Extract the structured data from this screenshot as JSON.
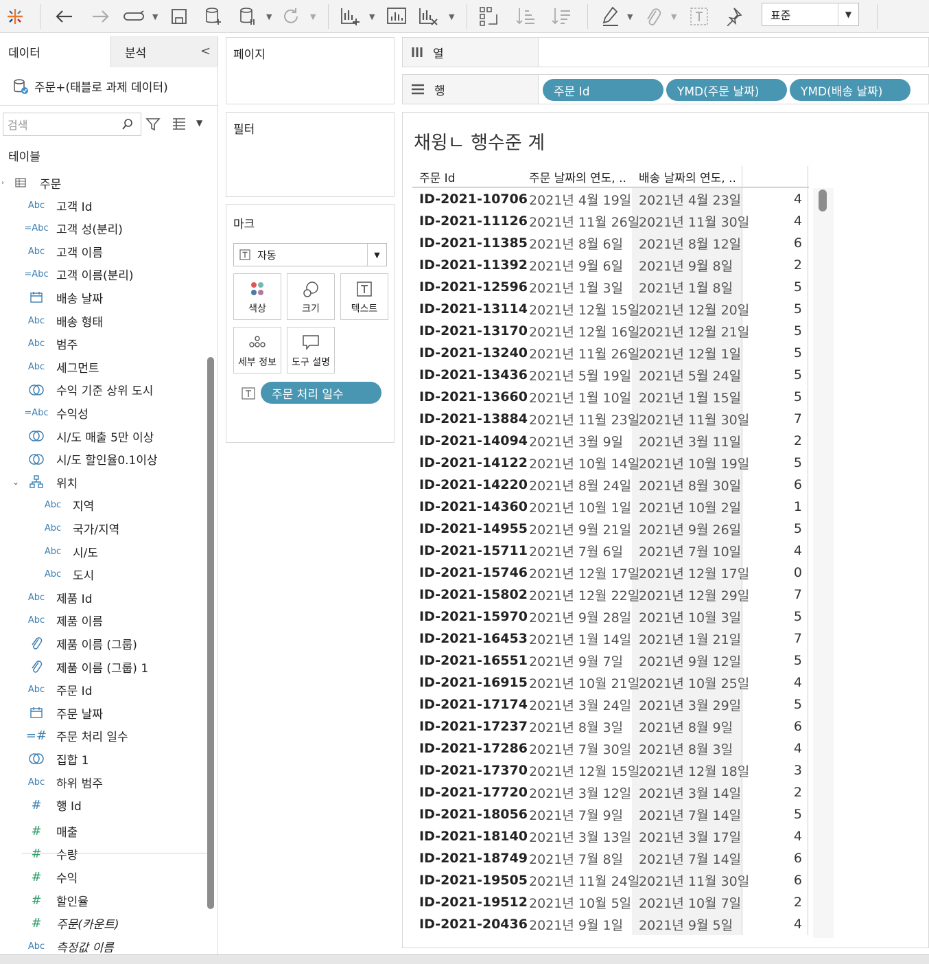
{
  "toolbar": {
    "icons": [
      "tableau-logo-icon",
      "undo-icon",
      "redo-icon",
      "replay-icon",
      "save-icon",
      "new-datasource-icon",
      "pause-update-icon",
      "refresh-icon",
      "new-worksheet-icon",
      "new-dashboard-icon",
      "clear-sheet-icon",
      "swap-icon",
      "sort-asc-icon",
      "sort-desc-icon",
      "highlight-icon",
      "group-icon",
      "show-labels-icon",
      "pin-icon"
    ],
    "fit_value": "표준"
  },
  "left_panel": {
    "tab_data": "데이터",
    "tab_analysis": "분석",
    "datasource": "주문+(태블로 과제 데이터)",
    "search_placeholder": "검색",
    "tables_header": "테이블",
    "table_name": "주문",
    "fields": [
      {
        "type": "Abc",
        "label": "고객 Id",
        "indent": 0
      },
      {
        "type": "=Abc",
        "label": "고객 성(분리)",
        "indent": 0
      },
      {
        "type": "Abc",
        "label": "고객 이름",
        "indent": 0
      },
      {
        "type": "=Abc",
        "label": "고객 이름(분리)",
        "indent": 0
      },
      {
        "type": "date",
        "label": "배송 날짜",
        "indent": 0
      },
      {
        "type": "Abc",
        "label": "배송 형태",
        "indent": 0
      },
      {
        "type": "Abc",
        "label": "범주",
        "indent": 0
      },
      {
        "type": "Abc",
        "label": "세그먼트",
        "indent": 0
      },
      {
        "type": "set",
        "label": "수익 기준 상위 도시",
        "indent": 0
      },
      {
        "type": "=Abc",
        "label": "수익성",
        "indent": 0
      },
      {
        "type": "set",
        "label": "시/도 매출 5만 이상",
        "indent": 0
      },
      {
        "type": "set",
        "label": "시/도 할인율0.1이상",
        "indent": 0
      },
      {
        "type": "hier",
        "label": "위치",
        "indent": 0
      },
      {
        "type": "Abc",
        "label": "지역",
        "indent": 1
      },
      {
        "type": "Abc",
        "label": "국가/지역",
        "indent": 1
      },
      {
        "type": "Abc",
        "label": "시/도",
        "indent": 1
      },
      {
        "type": "Abc",
        "label": "도시",
        "indent": 1
      },
      {
        "type": "Abc",
        "label": "제품 Id",
        "indent": 0
      },
      {
        "type": "Abc",
        "label": "제품 이름",
        "indent": 0
      },
      {
        "type": "clip",
        "label": "제품 이름 (그룹)",
        "indent": 0
      },
      {
        "type": "clip",
        "label": "제품 이름 (그룹) 1",
        "indent": 0
      },
      {
        "type": "Abc",
        "label": "주문 Id",
        "indent": 0
      },
      {
        "type": "date",
        "label": "주문 날짜",
        "indent": 0
      },
      {
        "type": "=#",
        "label": "주문 처리 일수",
        "indent": 0
      },
      {
        "type": "set",
        "label": "집합 1",
        "indent": 0
      },
      {
        "type": "Abc",
        "label": "하위 범주",
        "indent": 0
      },
      {
        "type": "#",
        "label": "행 Id",
        "indent": 0
      },
      {
        "type": "#g",
        "label": "매출",
        "indent": 0
      },
      {
        "type": "#g",
        "label": "수량",
        "indent": 0
      },
      {
        "type": "#g",
        "label": "수익",
        "indent": 0
      },
      {
        "type": "#g",
        "label": "할인율",
        "indent": 0
      },
      {
        "type": "#g",
        "label": "주문(카운트)",
        "indent": 0,
        "italic": true
      },
      {
        "type": "Abc",
        "label": "측정값 이름",
        "indent": 0,
        "italic": true
      }
    ]
  },
  "cards": {
    "pages": "페이지",
    "filters": "필터",
    "marks": "마크",
    "mark_type": "자동",
    "color": "색상",
    "size": "크기",
    "text": "텍스트",
    "detail": "세부 정보",
    "tooltip": "도구 설명",
    "text_pill": "주문 처리 일수"
  },
  "shelves": {
    "columns_label": "열",
    "rows_label": "행",
    "row_pills": [
      "주문 Id",
      "YMD(주문 날짜)",
      "YMD(배송 날짜)"
    ]
  },
  "view": {
    "title": "채윙ㄴ 행수준 계",
    "headers": [
      "주문 Id",
      "주문 날짜의 연도, ..",
      "배송 날짜의 연도, .."
    ],
    "rows": [
      [
        "ID-2021-10706",
        "2021년 4월 19일",
        "2021년 4월 23일",
        "4"
      ],
      [
        "ID-2021-11126",
        "2021년 11월 26일",
        "2021년 11월 30일",
        "4"
      ],
      [
        "ID-2021-11385",
        "2021년 8월 6일",
        "2021년 8월 12일",
        "6"
      ],
      [
        "ID-2021-11392",
        "2021년 9월 6일",
        "2021년 9월 8일",
        "2"
      ],
      [
        "ID-2021-12596",
        "2021년 1월 3일",
        "2021년 1월 8일",
        "5"
      ],
      [
        "ID-2021-13114",
        "2021년 12월 15일",
        "2021년 12월 20일",
        "5"
      ],
      [
        "ID-2021-13170",
        "2021년 12월 16일",
        "2021년 12월 21일",
        "5"
      ],
      [
        "ID-2021-13240",
        "2021년 11월 26일",
        "2021년 12월 1일",
        "5"
      ],
      [
        "ID-2021-13436",
        "2021년 5월 19일",
        "2021년 5월 24일",
        "5"
      ],
      [
        "ID-2021-13660",
        "2021년 1월 10일",
        "2021년 1월 15일",
        "5"
      ],
      [
        "ID-2021-13884",
        "2021년 11월 23일",
        "2021년 11월 30일",
        "7"
      ],
      [
        "ID-2021-14094",
        "2021년 3월 9일",
        "2021년 3월 11일",
        "2"
      ],
      [
        "ID-2021-14122",
        "2021년 10월 14일",
        "2021년 10월 19일",
        "5"
      ],
      [
        "ID-2021-14220",
        "2021년 8월 24일",
        "2021년 8월 30일",
        "6"
      ],
      [
        "ID-2021-14360",
        "2021년 10월 1일",
        "2021년 10월 2일",
        "1"
      ],
      [
        "ID-2021-14955",
        "2021년 9월 21일",
        "2021년 9월 26일",
        "5"
      ],
      [
        "ID-2021-15711",
        "2021년 7월 6일",
        "2021년 7월 10일",
        "4"
      ],
      [
        "ID-2021-15746",
        "2021년 12월 17일",
        "2021년 12월 17일",
        "0"
      ],
      [
        "ID-2021-15802",
        "2021년 12월 22일",
        "2021년 12월 29일",
        "7"
      ],
      [
        "ID-2021-15970",
        "2021년 9월 28일",
        "2021년 10월 3일",
        "5"
      ],
      [
        "ID-2021-16453",
        "2021년 1월 14일",
        "2021년 1월 21일",
        "7"
      ],
      [
        "ID-2021-16551",
        "2021년 9월 7일",
        "2021년 9월 12일",
        "5"
      ],
      [
        "ID-2021-16915",
        "2021년 10월 21일",
        "2021년 10월 25일",
        "4"
      ],
      [
        "ID-2021-17174",
        "2021년 3월 24일",
        "2021년 3월 29일",
        "5"
      ],
      [
        "ID-2021-17237",
        "2021년 8월 3일",
        "2021년 8월 9일",
        "6"
      ],
      [
        "ID-2021-17286",
        "2021년 7월 30일",
        "2021년 8월 3일",
        "4"
      ],
      [
        "ID-2021-17370",
        "2021년 12월 15일",
        "2021년 12월 18일",
        "3"
      ],
      [
        "ID-2021-17720",
        "2021년 3월 12일",
        "2021년 3월 14일",
        "2"
      ],
      [
        "ID-2021-18056",
        "2021년 7월 9일",
        "2021년 7월 14일",
        "5"
      ],
      [
        "ID-2021-18140",
        "2021년 3월 13일",
        "2021년 3월 17일",
        "4"
      ],
      [
        "ID-2021-18749",
        "2021년 7월 8일",
        "2021년 7월 14일",
        "6"
      ],
      [
        "ID-2021-19505",
        "2021년 11월 24일",
        "2021년 11월 30일",
        "6"
      ],
      [
        "ID-2021-19512",
        "2021년 10월 5일",
        "2021년 10월 7일",
        "2"
      ],
      [
        "ID-2021-20436",
        "2021년 9월 1일",
        "2021년 9월 5일",
        "4"
      ]
    ]
  },
  "colors": {
    "pill": "#4996b2",
    "field_blue": "#3c7fb2",
    "field_green": "#2f9e6a"
  }
}
